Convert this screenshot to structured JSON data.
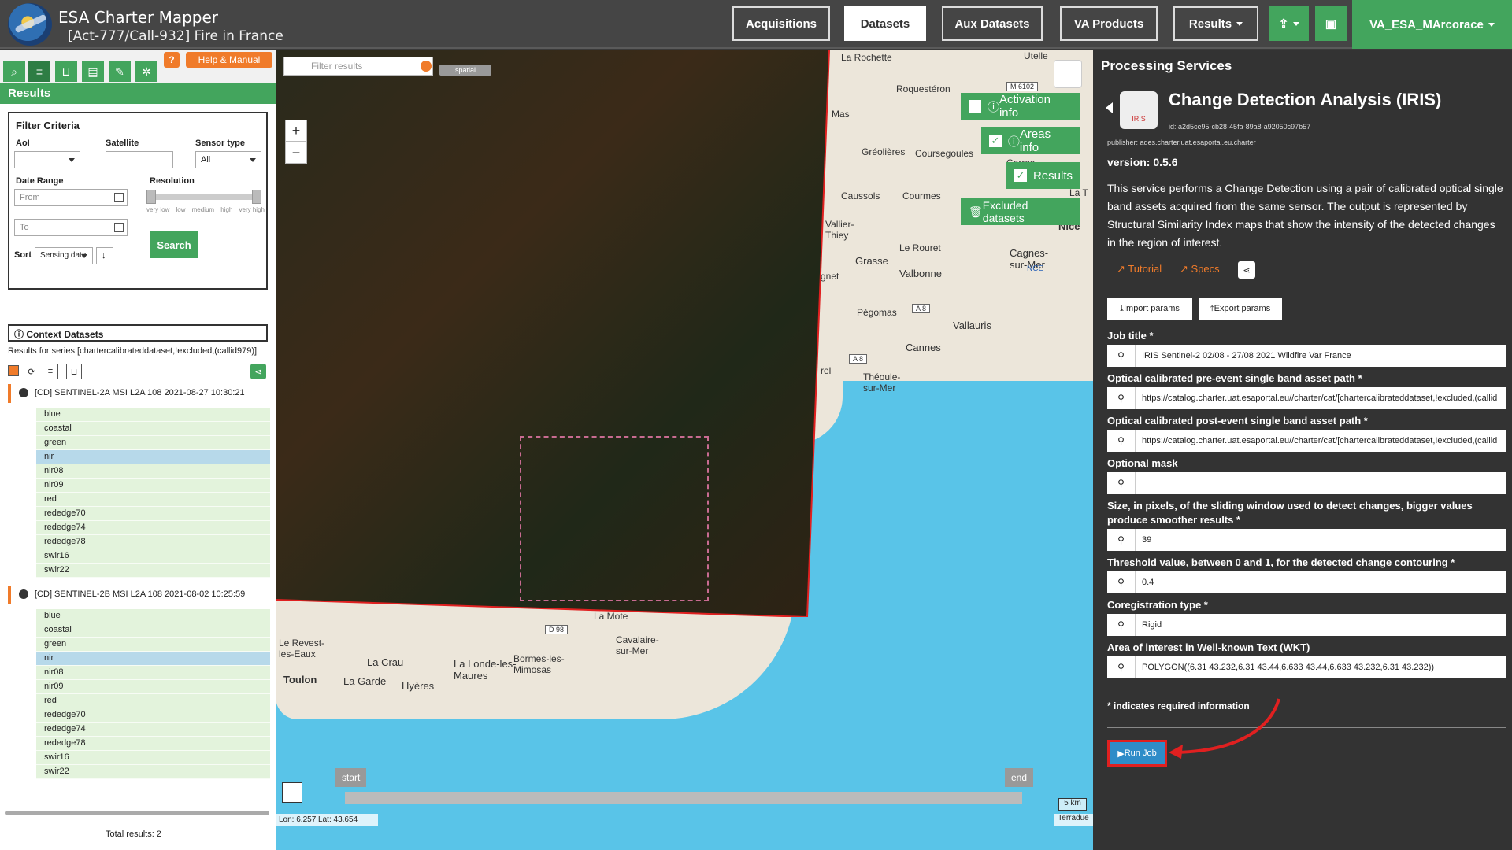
{
  "header": {
    "app_title": "ESA Charter Mapper",
    "activation_title": "[Act-777/Call-932] Fire in France",
    "nav": [
      "Acquisitions",
      "Datasets",
      "Aux Datasets",
      "VA Products",
      "Results"
    ],
    "user": "VA_ESA_MArcorace"
  },
  "left": {
    "help_label": "Help & Manual",
    "results_title": "Results",
    "filter": {
      "title": "Filter Criteria",
      "aoi_label": "AoI",
      "satellite_label": "Satellite",
      "sensor_label": "Sensor type",
      "sensor_value": "All",
      "date_label": "Date Range",
      "from_placeholder": "From",
      "to_placeholder": "To",
      "resolution_label": "Resolution",
      "resolution_levels": [
        "very low",
        "low",
        "medium",
        "high",
        "very high"
      ],
      "search_label": "Search",
      "sort_label": "Sort",
      "sort_value": "Sensing date"
    },
    "context_title": "Context Datasets",
    "series_text": "Results for series [chartercalibrateddataset,!excluded,(callid979)]",
    "datasets": [
      {
        "title": "[CD] SENTINEL-2A MSI L2A 108 2021-08-27 10:30:21",
        "bands": [
          "blue",
          "coastal",
          "green",
          "nir",
          "nir08",
          "nir09",
          "red",
          "rededge70",
          "rededge74",
          "rededge78",
          "swir16",
          "swir22"
        ]
      },
      {
        "title": "[CD] SENTINEL-2B MSI L2A 108 2021-08-02 10:25:59",
        "bands": [
          "blue",
          "coastal",
          "green",
          "nir",
          "nir08",
          "nir09",
          "red",
          "rededge70",
          "rededge74",
          "rededge78",
          "swir16",
          "swir22"
        ]
      }
    ],
    "selected_band": "nir",
    "total_results": "Total results: 2"
  },
  "map": {
    "filter_placeholder": "Filter results",
    "spatial_tag": "spatial",
    "activation_info": "Activation info",
    "areas_info": "Areas info",
    "results": "Results",
    "excluded": "Excluded datasets",
    "timeline_start": "start",
    "timeline_end": "end",
    "scale": "5 km",
    "attribution": "Terradue",
    "coords": "Lon: 6.257 Lat: 43.654",
    "places": [
      "La Rochette",
      "Roquestéron",
      "Mas",
      "Gréolières",
      "Coursegoules",
      "Carros",
      "Caussols",
      "Courmes",
      "Vallier-Thiey",
      "Grasse",
      "Le Rouret",
      "Valbonne",
      "Cagnes-sur-Mer",
      "Nice",
      "NCE",
      "Pégomas",
      "Vallauris",
      "Cannes",
      "Théoule-sur-Mer",
      "La Mote",
      "Le Revest-les-Eaux",
      "La Crau",
      "La Londe-les-Maures",
      "Bormes-les-Mimosas",
      "Cavalaire-sur-Mer",
      "Toulon",
      "La Garde",
      "Hyères",
      "Utelle",
      "La T",
      "gnet",
      "rel"
    ],
    "road_labels": [
      "M 6102",
      "A 8",
      "A 8",
      "D 98"
    ]
  },
  "right": {
    "heading": "Processing Services",
    "service_title": "Change Detection Analysis (IRIS)",
    "service_icon_label": "IRIS",
    "service_id": "id: a2d5ce95-cb28-45fa-89a8-a92050c97b57",
    "publisher": "publisher: ades.charter.uat.esaportal.eu.charter",
    "version": "version: 0.5.6",
    "description": "This service performs a Change Detection using a pair of calibrated optical single band assets acquired from the same sensor. The output is represented by Structural Similarity Index maps that show the intensity of the detected changes in the region of interest.",
    "tutorial": "Tutorial",
    "specs": "Specs",
    "import_params": "Import params",
    "export_params": "Export params",
    "fields": [
      {
        "label": "Job title *",
        "value": "IRIS Sentinel-2 02/08 - 27/08 2021 Wildfire Var France"
      },
      {
        "label": "Optical calibrated pre-event single band asset path *",
        "value": "https://catalog.charter.uat.esaportal.eu//charter/cat/[chartercalibrateddataset,!excluded,(callid"
      },
      {
        "label": "Optical calibrated post-event single band asset path *",
        "value": "https://catalog.charter.uat.esaportal.eu//charter/cat/[chartercalibrateddataset,!excluded,(callid"
      },
      {
        "label": "Optional mask",
        "value": ""
      },
      {
        "label": "Size, in pixels, of the sliding window used to detect changes, bigger values produce smoother results *",
        "value": "39"
      },
      {
        "label": "Threshold value, between 0 and 1, for the detected change contouring *",
        "value": "0.4"
      },
      {
        "label": "Coregistration type *",
        "value": "Rigid"
      },
      {
        "label": "Area of interest in Well-known Text (WKT)",
        "value": "POLYGON((6.31 43.232,6.31 43.44,6.633 43.44,6.633 43.232,6.31 43.232))"
      }
    ],
    "required_note": "* indicates required information",
    "run_job": "Run Job"
  },
  "colors": {
    "accent_green": "#43a55d",
    "orange": "#f07b2a",
    "run_blue": "#2e8cc8",
    "highlight_red": "#e02020"
  }
}
